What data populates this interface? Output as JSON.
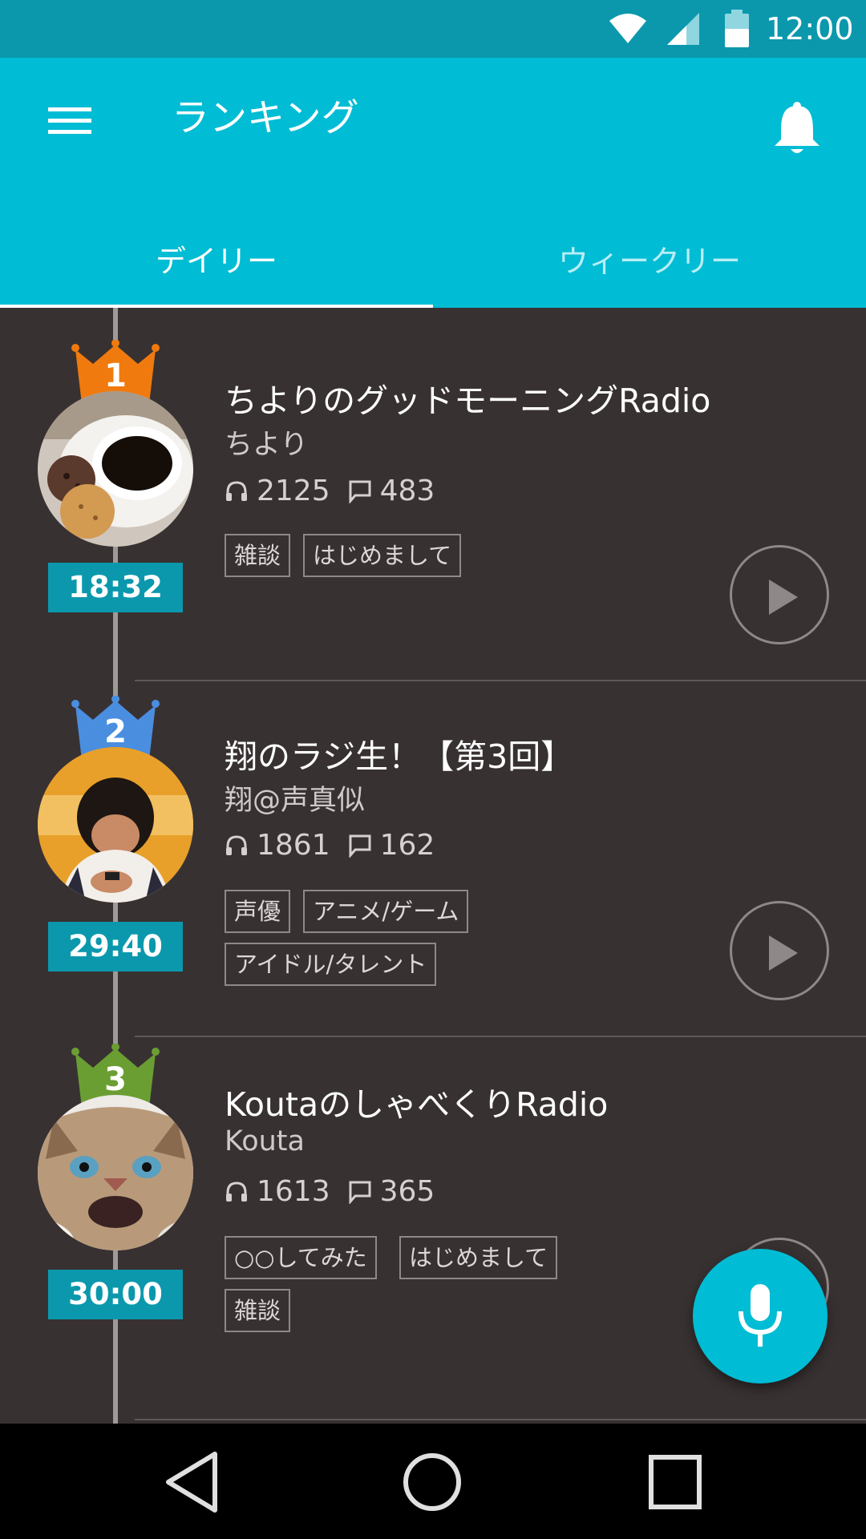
{
  "status_bar": {
    "time": "12:00",
    "icons": [
      "wifi-icon",
      "cell-signal-icon",
      "battery-icon"
    ]
  },
  "app_bar": {
    "title": "ランキング",
    "menu_icon": "hamburger-menu-icon",
    "notification_icon": "bell-icon"
  },
  "tabs": [
    {
      "label": "デイリー",
      "selected": true
    },
    {
      "label": "ウィークリー",
      "selected": false
    }
  ],
  "items": [
    {
      "rank": "1",
      "crown_color": "#f07a0e",
      "duration": "18:32",
      "title": "ちよりのグッドモーニングRadio",
      "author": "ちより",
      "listens": "2125",
      "comments": "483",
      "tags": [
        "雑談",
        "はじめまして"
      ],
      "avatar": "coffee-and-cookies-photo"
    },
    {
      "rank": "2",
      "crown_color": "#4a8ee0",
      "duration": "29:40",
      "title": "翔のラジ生！【第3回】",
      "author": "翔@声真似",
      "listens": "1861",
      "comments": "162",
      "tags": [
        "声優",
        "アニメ/ゲーム",
        "アイドル/タレント"
      ],
      "avatar": "man-with-phone-photo"
    },
    {
      "rank": "3",
      "crown_color": "#6a9e33",
      "duration": "30:00",
      "title": "KoutaのしゃべくりRadio",
      "author": "Kouta",
      "listens": "1613",
      "comments": "365",
      "tags": [
        "○○してみた",
        "はじめまして",
        "雑談"
      ],
      "avatar": "cat-face-photo"
    }
  ],
  "fab": {
    "icon": "microphone-icon"
  },
  "nav_bar": {
    "icons": [
      "back-icon",
      "home-icon",
      "recent-apps-icon"
    ]
  },
  "colors": {
    "primary": "#00bcd4",
    "status_bar": "#0b98ad",
    "list_background": "#383132",
    "duration_badge": "#0b98ad"
  }
}
